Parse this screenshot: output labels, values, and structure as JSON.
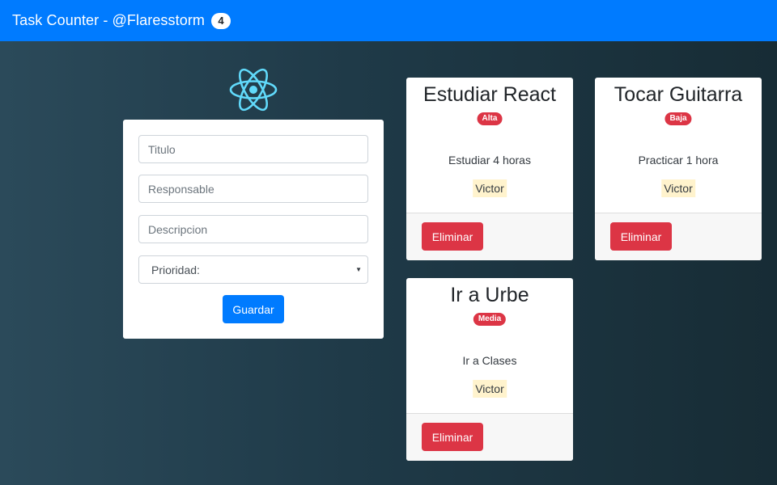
{
  "navbar": {
    "title": "Task Counter - @Flaresstorm",
    "task_count": "4"
  },
  "logo": {
    "icon": "react-atom-icon",
    "color": "#61dafb"
  },
  "form": {
    "titulo_placeholder": "Titulo",
    "responsable_placeholder": "Responsable",
    "descripcion_placeholder": "Descripcion",
    "prioridad_selected": "Prioridad:",
    "save_label": "Guardar"
  },
  "tasks": [
    {
      "title": "Estudiar React",
      "priority": "Alta",
      "description": "Estudiar 4 horas",
      "responsible": "Victor",
      "delete_label": "Eliminar"
    },
    {
      "title": "Tocar Guitarra",
      "priority": "Baja",
      "description": "Practicar 1 hora",
      "responsible": "Victor",
      "delete_label": "Eliminar"
    },
    {
      "title": "Ir a Urbe",
      "priority": "Media",
      "description": "Ir a Clases",
      "responsible": "Victor",
      "delete_label": "Eliminar"
    }
  ],
  "colors": {
    "primary": "#007bff",
    "danger": "#dc3545",
    "highlight": "#fff3cd"
  }
}
